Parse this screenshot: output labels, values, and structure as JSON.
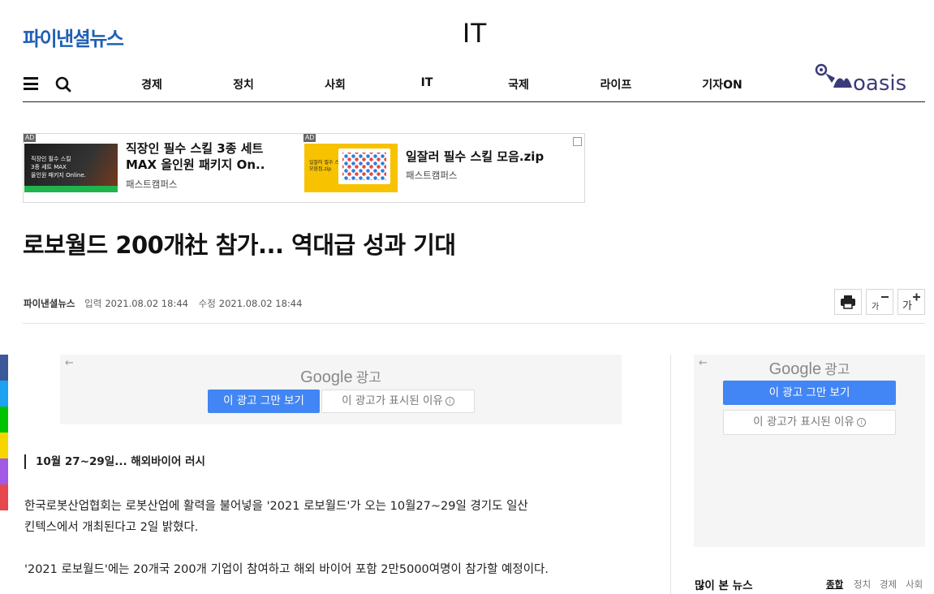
{
  "site": {
    "logo_text": "파이낸셜뉴스",
    "section_title": "IT"
  },
  "nav": {
    "items": [
      "경제",
      "정치",
      "사회",
      "IT",
      "국제",
      "라이프",
      "기자ON"
    ],
    "partner_logo": "oasis"
  },
  "ad_banner": {
    "tag": "AD",
    "items": [
      {
        "title_line1": "직장인 필수 스킬 3종 세트",
        "title_line2": "MAX 올인원 패키지 On..",
        "source": "패스트캠퍼스",
        "thumb_text": [
          "직장인 필수 스킬",
          "3종 세트 MAX",
          "올인원 패키지 Online."
        ]
      },
      {
        "title": "일잘러 필수 스킬 모음.zip",
        "source": "패스트캠퍼스",
        "thumb_text": [
          "일잘러 필수 스킬",
          "모음집.zip"
        ]
      }
    ]
  },
  "article": {
    "headline": "로보월드 200개社 참가... 역대급 성과 기대",
    "source": "파이낸셜뉴스",
    "input_label": "입력",
    "input_date": "2021.08.02 18:44",
    "modified_label": "수정",
    "modified_date": "2021.08.02 18:44",
    "tools": {
      "font_decrease": "가",
      "font_increase": "가"
    },
    "subheading": "10월 27~29일... 해외바이어 러시",
    "paragraphs": [
      "한국로봇산업협회는 로봇산업에 활력을 불어넣을 '2021 로보월드'가 오는 10월27~29일 경기도 일산",
      "킨텍스에서 개최된다고 2일 밝혔다.",
      "'2021 로보월드'에는 20개국 200개 기업이 참여하고 해외 바이어 포함 2만5000여명이 참가할 예정이다."
    ]
  },
  "google_ads": {
    "logo": "Google",
    "ad_word": "광고",
    "stop_label": "이 광고 그만 보기",
    "why_label": "이 광고가 표시된 이유",
    "back_arrow": "←",
    "info_glyph": "i"
  },
  "popular": {
    "title": "많이 본 뉴스",
    "tabs": [
      "종합",
      "정치",
      "경제",
      "사회"
    ]
  },
  "colors": {
    "brand": "#1f5fb6",
    "google_blue": "#4285f4",
    "social": [
      "#3b5998",
      "#1da1f2",
      "#00c300",
      "#f7d600",
      "#a259e6",
      "#e5484d"
    ]
  }
}
